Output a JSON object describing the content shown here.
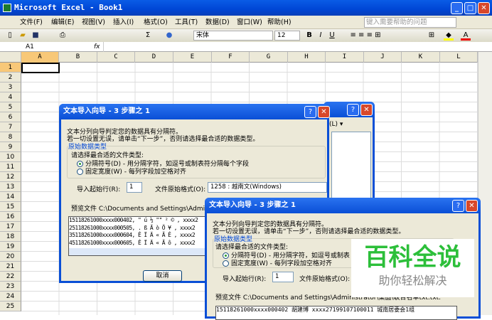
{
  "window": {
    "title": "Microsoft Excel - Book1"
  },
  "menu": [
    "文件(F)",
    "编辑(E)",
    "视图(V)",
    "插入(I)",
    "格式(O)",
    "工具(T)",
    "数据(D)",
    "窗口(W)",
    "帮助(H)"
  ],
  "help_box": "键入需要帮助的问题",
  "toolbar": {
    "font": "宋体",
    "size": "12",
    "bold": "B",
    "italic": "I",
    "underline": "U",
    "sum": "Σ"
  },
  "formula": {
    "name_box": "A1",
    "fx": "fx"
  },
  "columns": [
    "A",
    "B",
    "C",
    "D",
    "E",
    "F",
    "G",
    "H",
    "I",
    "J",
    "K",
    "L"
  ],
  "rows": [
    "1",
    "2",
    "3",
    "4",
    "5",
    "6",
    "7",
    "8",
    "9",
    "10",
    "11",
    "12",
    "13",
    "14",
    "15",
    "16",
    "17",
    "18",
    "19",
    "20",
    "21",
    "22",
    "23",
    "24",
    "25"
  ],
  "behind_dialog": {
    "fragment": "(L) ▾"
  },
  "dialog1": {
    "title": "文本导入向导 - 3 步骤之 1",
    "line1": "文本分列向导判定您的数据具有分隔符。",
    "line2": "若一切设置无误，请单击“下一步”，否则请选择最合适的数据类型。",
    "group": "原始数据类型",
    "prompt": "请选择最合适的文件类型:",
    "opt1": "分隔符号(D)",
    "opt1_desc": "- 用分隔字符，如逗号或制表符分隔每个字段",
    "opt2": "固定宽度(W)",
    "opt2_desc": "- 每列字段加空格对齐",
    "start_label": "导入起始行(R):",
    "start_value": "1",
    "origin_label": "文件原始格式(O):",
    "origin_value": "1258 : 越南文(Windows)",
    "preview_label": "预览文件 C:\\Documents and Settings\\Administ",
    "preview": [
      {
        "n": "1",
        "t": "5118261000xxxx000402, \" ú ½ \"\" ² ©  , xxxx2"
      },
      {
        "n": "2",
        "t": "5118261000xxxx000505,  . ß Ã ò Õ ¥  , xxxx2"
      },
      {
        "n": "3",
        "t": "5118261000xxxx000604, Ê Ï Ä « Ã Ê  , xxxx2"
      },
      {
        "n": "4",
        "t": "5118261000xxxx000605, Ê Ï Ä « Ã ô  , xxxx2"
      }
    ],
    "cancel": "取消"
  },
  "dialog2": {
    "title": "文本导入向导 - 3 步骤之 1",
    "line1": "文本分列向导判定您的数据具有分隔符。",
    "line2": "若一切设置无误，请单击“下一步”，否则请选择最合适的数据类型。",
    "group": "原始数据类型",
    "prompt": "请选择最合适的文件类型:",
    "opt1": "分隔符号(D)",
    "opt1_desc": "- 用分隔字符，如逗号或制表",
    "opt2": "固定宽度(W)",
    "opt2_desc": "- 每列字段加空格对齐",
    "start_label": "导入起始行(R):",
    "start_value": "1",
    "origin_label": "文件原始格式(O):",
    "preview_label": "预览文件 C:\\Documents and Settings\\Administrator\\桌面\\联合名单txt.txt.",
    "preview_row": {
      "n": "1",
      "t": "5118261000xxxx000402  胡建博  xxxx27199107100011  城南居委会1组"
    }
  },
  "watermark": {
    "title": "百科全说",
    "subtitle": "助你轻松解决"
  }
}
